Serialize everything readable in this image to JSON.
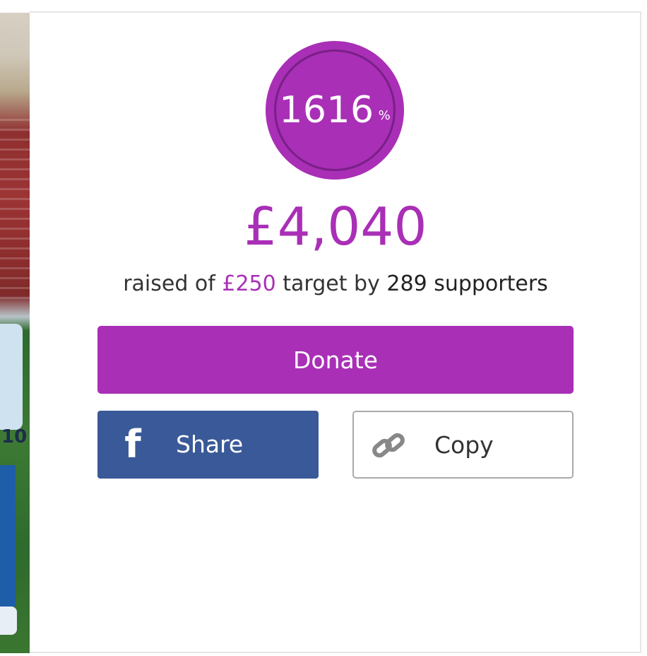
{
  "progress": {
    "percent": "1616",
    "unit": "%"
  },
  "fundraising": {
    "raised": "£4,040",
    "summary_prefix": "raised of",
    "target": "£250",
    "summary_middle": "target by",
    "supporters": "289 supporters"
  },
  "actions": {
    "donate_label": "Donate",
    "share_label": "Share",
    "copy_label": "Copy"
  },
  "photo": {
    "kit_number": "10"
  },
  "icons": {
    "share": "facebook-icon",
    "copy": "link-icon"
  },
  "colors": {
    "accent": "#a92fb6",
    "facebook": "#3a5998",
    "text": "#333333"
  }
}
